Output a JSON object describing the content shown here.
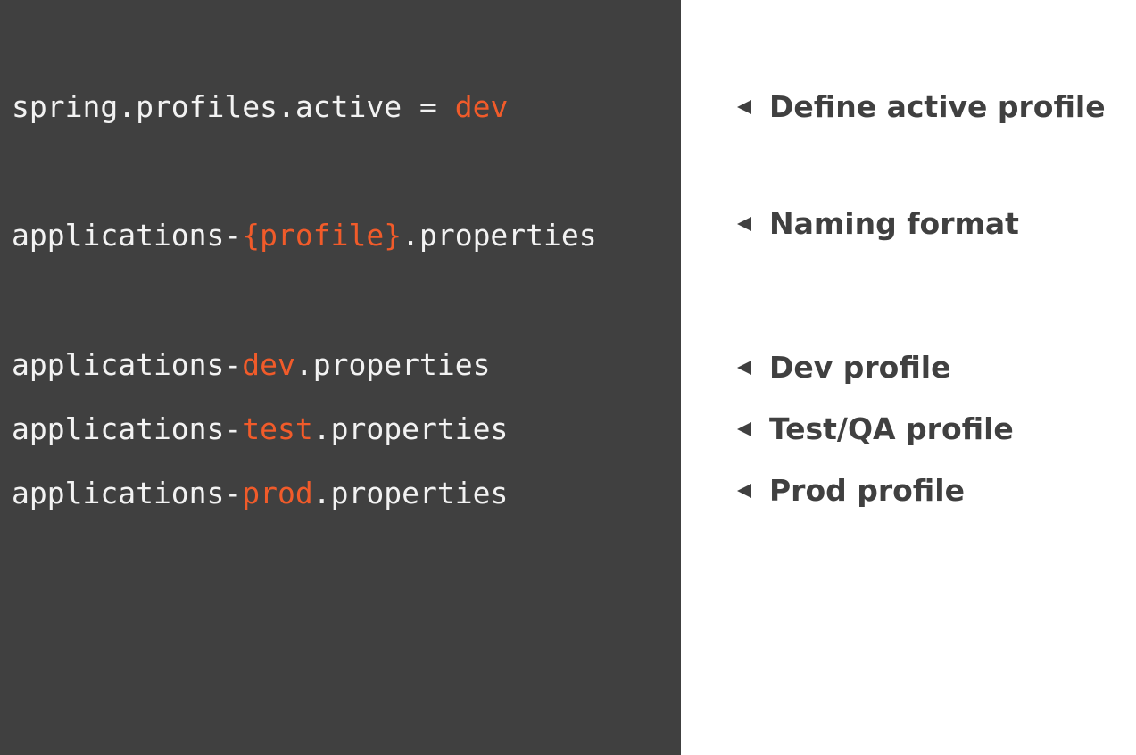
{
  "colors": {
    "code_background": "#404040",
    "code_text": "#f2f2f2",
    "highlight": "#f15b2a",
    "note_text": "#404040",
    "right_background": "#ffffff"
  },
  "code_lines": [
    {
      "prefix": "spring.profiles.active = ",
      "highlight": "dev",
      "suffix": ""
    },
    {
      "prefix": "applications-",
      "highlight": "{profile}",
      "suffix": ".properties"
    },
    {
      "prefix": "applications-",
      "highlight": "dev",
      "suffix": ".properties"
    },
    {
      "prefix": "applications-",
      "highlight": "test",
      "suffix": ".properties"
    },
    {
      "prefix": "applications-",
      "highlight": "prod",
      "suffix": ".properties"
    }
  ],
  "notes": [
    {
      "icon": "arrow-left-icon",
      "label": "Define active profile"
    },
    {
      "icon": "arrow-left-icon",
      "label": "Naming format"
    },
    {
      "icon": "arrow-left-icon",
      "label": "Dev profile"
    },
    {
      "icon": "arrow-left-icon",
      "label": "Test/QA profile"
    },
    {
      "icon": "arrow-left-icon",
      "label": "Prod profile"
    }
  ]
}
